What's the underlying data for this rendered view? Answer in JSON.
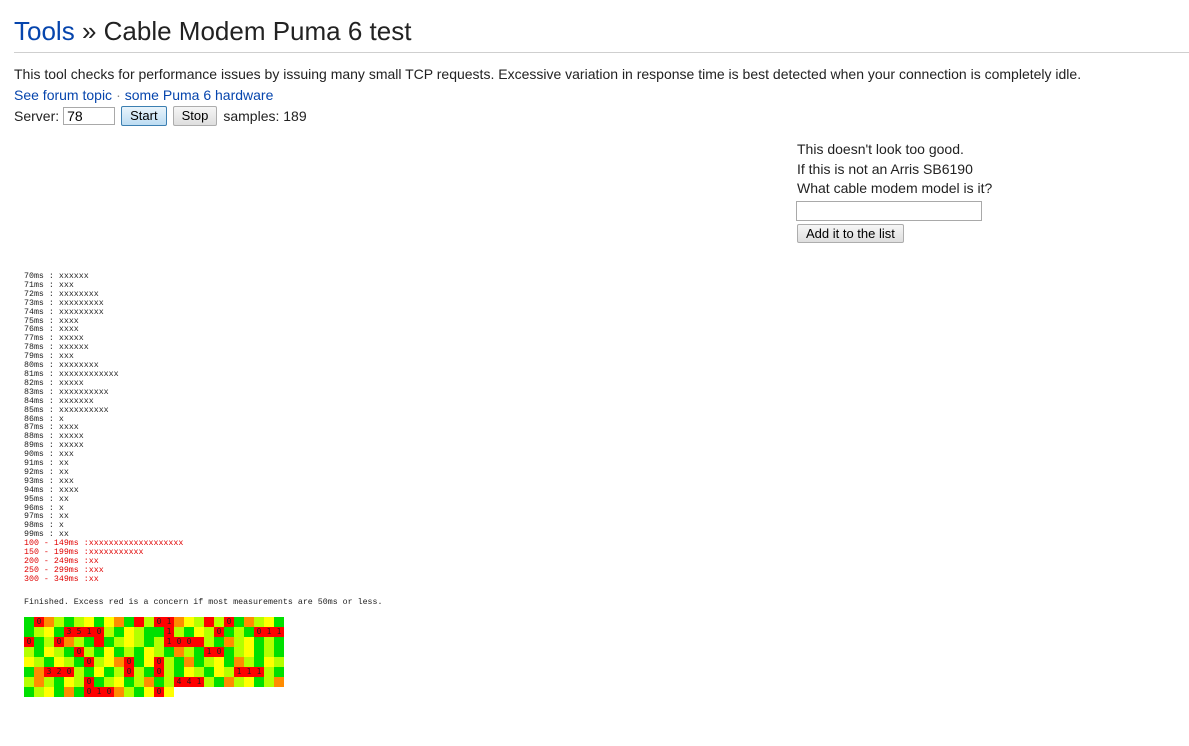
{
  "header": {
    "breadcrumb_link": "Tools",
    "separator": "»",
    "page_title": "Cable Modem Puma 6 test"
  },
  "description": "This tool checks for performance issues by issuing many small TCP requests. Excessive variation in response time is best detected when your connection is completely idle.",
  "links": {
    "forum": "See forum topic",
    "dot": "·",
    "hardware": "some Puma 6 hardware"
  },
  "controls": {
    "server_label": "Server:",
    "server_value": "78",
    "start_label": "Start",
    "stop_label": "Stop",
    "samples_text": "samples: 189"
  },
  "side_panel": {
    "line1": "This doesn't look too good.",
    "line2": "If this is not an Arris SB6190",
    "line3": "What cable modem model is it?",
    "input_value": "",
    "add_button": "Add it to the list"
  },
  "histogram": [
    {
      "label": "70ms : ",
      "bar": "xxxxxx",
      "red": false
    },
    {
      "label": "71ms : ",
      "bar": "xxx",
      "red": false
    },
    {
      "label": "72ms : ",
      "bar": "xxxxxxxx",
      "red": false
    },
    {
      "label": "73ms : ",
      "bar": "xxxxxxxxx",
      "red": false
    },
    {
      "label": "74ms : ",
      "bar": "xxxxxxxxx",
      "red": false
    },
    {
      "label": "75ms : ",
      "bar": "xxxx",
      "red": false
    },
    {
      "label": "76ms : ",
      "bar": "xxxx",
      "red": false
    },
    {
      "label": "77ms : ",
      "bar": "xxxxx",
      "red": false
    },
    {
      "label": "78ms : ",
      "bar": "xxxxxx",
      "red": false
    },
    {
      "label": "79ms : ",
      "bar": "xxx",
      "red": false
    },
    {
      "label": "80ms : ",
      "bar": "xxxxxxxx",
      "red": false
    },
    {
      "label": "81ms : ",
      "bar": "xxxxxxxxxxxx",
      "red": false
    },
    {
      "label": "82ms : ",
      "bar": "xxxxx",
      "red": false
    },
    {
      "label": "83ms : ",
      "bar": "xxxxxxxxxx",
      "red": false
    },
    {
      "label": "84ms : ",
      "bar": "xxxxxxx",
      "red": false
    },
    {
      "label": "85ms : ",
      "bar": "xxxxxxxxxx",
      "red": false
    },
    {
      "label": "86ms : ",
      "bar": "x",
      "red": false
    },
    {
      "label": "87ms : ",
      "bar": "xxxx",
      "red": false
    },
    {
      "label": "88ms : ",
      "bar": "xxxxx",
      "red": false
    },
    {
      "label": "89ms : ",
      "bar": "xxxxx",
      "red": false
    },
    {
      "label": "90ms : ",
      "bar": "xxx",
      "red": false
    },
    {
      "label": "91ms : ",
      "bar": "xx",
      "red": false
    },
    {
      "label": "92ms : ",
      "bar": "xx",
      "red": false
    },
    {
      "label": "93ms : ",
      "bar": "xxx",
      "red": false
    },
    {
      "label": "94ms : ",
      "bar": "xxxx",
      "red": false
    },
    {
      "label": "95ms : ",
      "bar": "xx",
      "red": false
    },
    {
      "label": "96ms : ",
      "bar": "x",
      "red": false
    },
    {
      "label": "97ms : ",
      "bar": "xx",
      "red": false
    },
    {
      "label": "98ms : ",
      "bar": "x",
      "red": false
    },
    {
      "label": "99ms : ",
      "bar": "xx",
      "red": false
    },
    {
      "label": "100 - 149ms :",
      "bar": "xxxxxxxxxxxxxxxxxxx",
      "red": true
    },
    {
      "label": "150 - 199ms :",
      "bar": "xxxxxxxxxxx",
      "red": true
    },
    {
      "label": "200 - 249ms :",
      "bar": "xx",
      "red": true
    },
    {
      "label": "250 - 299ms :",
      "bar": "xxx",
      "red": true
    },
    {
      "label": "300 - 349ms :",
      "bar": "xx",
      "red": true
    }
  ],
  "finished_text": "Finished. Excess red is a concern if most measurements are 50ms or less.",
  "colors": {
    "red": "#ff0000",
    "orange": "#ff8c00",
    "yellow": "#ffff00",
    "yellowgreen": "#b4ff00",
    "green": "#00e000",
    "link": "#0645ad"
  },
  "heatmap": {
    "columns": 26,
    "cells": [
      {
        "c": "G",
        "t": ""
      },
      {
        "c": "R",
        "t": "0"
      },
      {
        "c": "O",
        "t": ""
      },
      {
        "c": "L",
        "t": ""
      },
      {
        "c": "G",
        "t": ""
      },
      {
        "c": "L",
        "t": ""
      },
      {
        "c": "Y",
        "t": ""
      },
      {
        "c": "G",
        "t": ""
      },
      {
        "c": "Y",
        "t": ""
      },
      {
        "c": "O",
        "t": ""
      },
      {
        "c": "G",
        "t": ""
      },
      {
        "c": "R",
        "t": ""
      },
      {
        "c": "L",
        "t": ""
      },
      {
        "c": "R",
        "t": "0"
      },
      {
        "c": "R",
        "t": "1"
      },
      {
        "c": "O",
        "t": ""
      },
      {
        "c": "Y",
        "t": ""
      },
      {
        "c": "L",
        "t": ""
      },
      {
        "c": "R",
        "t": ""
      },
      {
        "c": "L",
        "t": ""
      },
      {
        "c": "R",
        "t": "0"
      },
      {
        "c": "G",
        "t": ""
      },
      {
        "c": "O",
        "t": ""
      },
      {
        "c": "L",
        "t": ""
      },
      {
        "c": "Y",
        "t": ""
      },
      {
        "c": "G",
        "t": ""
      },
      {
        "c": "G",
        "t": ""
      },
      {
        "c": "L",
        "t": ""
      },
      {
        "c": "Y",
        "t": ""
      },
      {
        "c": "G",
        "t": ""
      },
      {
        "c": "R",
        "t": "3"
      },
      {
        "c": "R",
        "t": "5"
      },
      {
        "c": "R",
        "t": "1"
      },
      {
        "c": "R",
        "t": "0"
      },
      {
        "c": "L",
        "t": ""
      },
      {
        "c": "G",
        "t": ""
      },
      {
        "c": "Y",
        "t": ""
      },
      {
        "c": "L",
        "t": ""
      },
      {
        "c": "G",
        "t": ""
      },
      {
        "c": "G",
        "t": ""
      },
      {
        "c": "R",
        "t": "1"
      },
      {
        "c": "L",
        "t": ""
      },
      {
        "c": "G",
        "t": ""
      },
      {
        "c": "Y",
        "t": ""
      },
      {
        "c": "L",
        "t": ""
      },
      {
        "c": "R",
        "t": "0"
      },
      {
        "c": "G",
        "t": ""
      },
      {
        "c": "L",
        "t": ""
      },
      {
        "c": "G",
        "t": ""
      },
      {
        "c": "R",
        "t": "0"
      },
      {
        "c": "R",
        "t": "1"
      },
      {
        "c": "R",
        "t": "1"
      },
      {
        "c": "R",
        "t": "0"
      },
      {
        "c": "G",
        "t": ""
      },
      {
        "c": "L",
        "t": ""
      },
      {
        "c": "R",
        "t": "0"
      },
      {
        "c": "O",
        "t": ""
      },
      {
        "c": "L",
        "t": ""
      },
      {
        "c": "G",
        "t": ""
      },
      {
        "c": "R",
        "t": ""
      },
      {
        "c": "G",
        "t": ""
      },
      {
        "c": "L",
        "t": ""
      },
      {
        "c": "Y",
        "t": ""
      },
      {
        "c": "L",
        "t": ""
      },
      {
        "c": "G",
        "t": ""
      },
      {
        "c": "L",
        "t": ""
      },
      {
        "c": "R",
        "t": "1"
      },
      {
        "c": "R",
        "t": "0"
      },
      {
        "c": "R",
        "t": "0"
      },
      {
        "c": "R",
        "t": ""
      },
      {
        "c": "L",
        "t": ""
      },
      {
        "c": "G",
        "t": ""
      },
      {
        "c": "O",
        "t": ""
      },
      {
        "c": "L",
        "t": ""
      },
      {
        "c": "Y",
        "t": ""
      },
      {
        "c": "G",
        "t": ""
      },
      {
        "c": "L",
        "t": ""
      },
      {
        "c": "G",
        "t": ""
      },
      {
        "c": "L",
        "t": ""
      },
      {
        "c": "G",
        "t": ""
      },
      {
        "c": "Y",
        "t": ""
      },
      {
        "c": "L",
        "t": ""
      },
      {
        "c": "G",
        "t": ""
      },
      {
        "c": "R",
        "t": "0"
      },
      {
        "c": "L",
        "t": ""
      },
      {
        "c": "G",
        "t": ""
      },
      {
        "c": "Y",
        "t": ""
      },
      {
        "c": "G",
        "t": ""
      },
      {
        "c": "L",
        "t": ""
      },
      {
        "c": "G",
        "t": ""
      },
      {
        "c": "Y",
        "t": ""
      },
      {
        "c": "L",
        "t": ""
      },
      {
        "c": "G",
        "t": ""
      },
      {
        "c": "O",
        "t": ""
      },
      {
        "c": "L",
        "t": ""
      },
      {
        "c": "G",
        "t": ""
      },
      {
        "c": "R",
        "t": "1"
      },
      {
        "c": "R",
        "t": "0"
      },
      {
        "c": "G",
        "t": ""
      },
      {
        "c": "L",
        "t": ""
      },
      {
        "c": "Y",
        "t": ""
      },
      {
        "c": "G",
        "t": ""
      },
      {
        "c": "L",
        "t": ""
      },
      {
        "c": "G",
        "t": ""
      },
      {
        "c": "Y",
        "t": ""
      },
      {
        "c": "L",
        "t": ""
      },
      {
        "c": "G",
        "t": ""
      },
      {
        "c": "Y",
        "t": ""
      },
      {
        "c": "L",
        "t": ""
      },
      {
        "c": "G",
        "t": ""
      },
      {
        "c": "R",
        "t": "0"
      },
      {
        "c": "L",
        "t": ""
      },
      {
        "c": "Y",
        "t": ""
      },
      {
        "c": "O",
        "t": ""
      },
      {
        "c": "R",
        "t": "0"
      },
      {
        "c": "G",
        "t": ""
      },
      {
        "c": "Y",
        "t": ""
      },
      {
        "c": "R",
        "t": "0"
      },
      {
        "c": "L",
        "t": ""
      },
      {
        "c": "G",
        "t": ""
      },
      {
        "c": "O",
        "t": ""
      },
      {
        "c": "G",
        "t": ""
      },
      {
        "c": "L",
        "t": ""
      },
      {
        "c": "Y",
        "t": ""
      },
      {
        "c": "G",
        "t": ""
      },
      {
        "c": "O",
        "t": ""
      },
      {
        "c": "L",
        "t": ""
      },
      {
        "c": "G",
        "t": ""
      },
      {
        "c": "Y",
        "t": ""
      },
      {
        "c": "L",
        "t": ""
      },
      {
        "c": "G",
        "t": ""
      },
      {
        "c": "O",
        "t": ""
      },
      {
        "c": "R",
        "t": "3"
      },
      {
        "c": "R",
        "t": "2"
      },
      {
        "c": "R",
        "t": "0"
      },
      {
        "c": "L",
        "t": ""
      },
      {
        "c": "G",
        "t": ""
      },
      {
        "c": "Y",
        "t": ""
      },
      {
        "c": "G",
        "t": ""
      },
      {
        "c": "L",
        "t": ""
      },
      {
        "c": "R",
        "t": "0"
      },
      {
        "c": "L",
        "t": ""
      },
      {
        "c": "G",
        "t": ""
      },
      {
        "c": "R",
        "t": "0"
      },
      {
        "c": "L",
        "t": ""
      },
      {
        "c": "G",
        "t": ""
      },
      {
        "c": "Y",
        "t": ""
      },
      {
        "c": "L",
        "t": ""
      },
      {
        "c": "G",
        "t": ""
      },
      {
        "c": "Y",
        "t": ""
      },
      {
        "c": "L",
        "t": ""
      },
      {
        "c": "R",
        "t": "1"
      },
      {
        "c": "R",
        "t": "1"
      },
      {
        "c": "R",
        "t": "1"
      },
      {
        "c": "L",
        "t": ""
      },
      {
        "c": "G",
        "t": ""
      },
      {
        "c": "L",
        "t": ""
      },
      {
        "c": "O",
        "t": ""
      },
      {
        "c": "L",
        "t": ""
      },
      {
        "c": "G",
        "t": ""
      },
      {
        "c": "Y",
        "t": ""
      },
      {
        "c": "L",
        "t": ""
      },
      {
        "c": "R",
        "t": "0"
      },
      {
        "c": "G",
        "t": ""
      },
      {
        "c": "L",
        "t": ""
      },
      {
        "c": "Y",
        "t": ""
      },
      {
        "c": "G",
        "t": ""
      },
      {
        "c": "L",
        "t": ""
      },
      {
        "c": "O",
        "t": ""
      },
      {
        "c": "G",
        "t": ""
      },
      {
        "c": "L",
        "t": ""
      },
      {
        "c": "R",
        "t": "4"
      },
      {
        "c": "R",
        "t": "4"
      },
      {
        "c": "R",
        "t": "1"
      },
      {
        "c": "L",
        "t": ""
      },
      {
        "c": "G",
        "t": ""
      },
      {
        "c": "O",
        "t": ""
      },
      {
        "c": "L",
        "t": ""
      },
      {
        "c": "Y",
        "t": ""
      },
      {
        "c": "G",
        "t": ""
      },
      {
        "c": "L",
        "t": ""
      },
      {
        "c": "O",
        "t": ""
      },
      {
        "c": "G",
        "t": ""
      },
      {
        "c": "L",
        "t": ""
      },
      {
        "c": "Y",
        "t": ""
      },
      {
        "c": "G",
        "t": ""
      },
      {
        "c": "O",
        "t": ""
      },
      {
        "c": "G",
        "t": ""
      },
      {
        "c": "R",
        "t": "0"
      },
      {
        "c": "R",
        "t": "1"
      },
      {
        "c": "R",
        "t": "0"
      },
      {
        "c": "O",
        "t": ""
      },
      {
        "c": "L",
        "t": ""
      },
      {
        "c": "G",
        "t": ""
      },
      {
        "c": "Y",
        "t": ""
      },
      {
        "c": "R",
        "t": "0"
      },
      {
        "c": "Y",
        "t": ""
      }
    ]
  }
}
